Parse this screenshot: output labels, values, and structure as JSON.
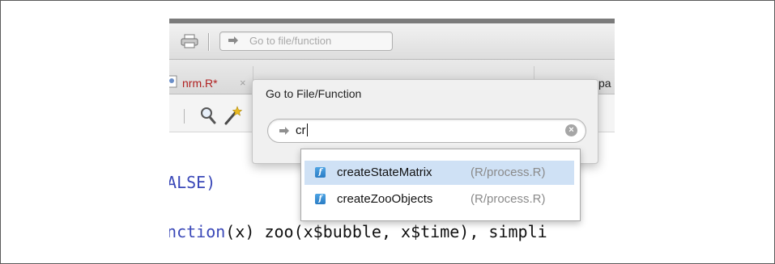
{
  "toolbar": {
    "goto_placeholder": "Go to file/function",
    "icons": [
      "print-icon",
      "arrow-icon"
    ]
  },
  "tabs": {
    "active_label": "nrm.R*",
    "close_glyph": "×",
    "right_label": "pa"
  },
  "editor_toolbar": {
    "icons": [
      "search-icon",
      "magic-wand-icon"
    ]
  },
  "code": {
    "line1": "FALSE)",
    "line2_fn": "unction",
    "line2_rest": "(x) zoo(x$bubble, x$time), simpli"
  },
  "dialog": {
    "title": "Go to File/Function",
    "input_value": "cr",
    "clear_glyph": "×"
  },
  "suggestions": [
    {
      "name": "createStateMatrix",
      "path": "(R/process.R)",
      "icon_glyph": "f",
      "selected": true
    },
    {
      "name": "createZooObjects",
      "path": "(R/process.R)",
      "icon_glyph": "f",
      "selected": false
    }
  ],
  "colors": {
    "tab_label": "#b02020",
    "keyword_blue": "#3a48b8",
    "selection": "#cfe1f5",
    "fn_icon": "#3b8fd4"
  }
}
